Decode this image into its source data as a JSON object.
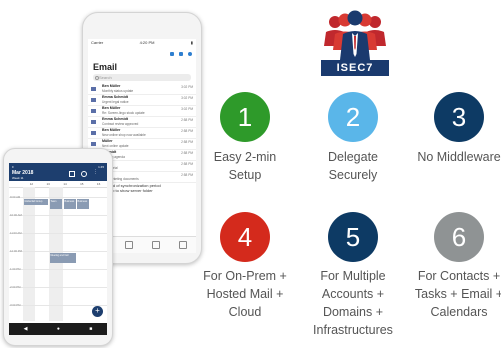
{
  "email_app": {
    "carrier": "Carrier",
    "clock": "4:20 PM",
    "title": "Email",
    "search_placeholder": "Search",
    "messages": [
      {
        "from": "Ben Müller",
        "subject": "Monthly status update",
        "time": "3:02 PM"
      },
      {
        "from": "Emma Schmidt",
        "subject": "Urgent legal notice",
        "time": "3:02 PM"
      },
      {
        "from": "Ben Müller",
        "subject": "Re: Screen-lingo stock update",
        "time": "3:02 PM"
      },
      {
        "from": "Emma Schmidt",
        "subject": "Contract review approved",
        "time": "2:58 PM"
      },
      {
        "from": "Ben Müller",
        "subject": "New online shop now available",
        "time": "2:58 PM"
      },
      {
        "from": "Müller",
        "subject": "Next online update",
        "time": "2:58 PM"
      },
      {
        "from": "Schmidt",
        "subject": "meeting agenda",
        "time": "2:58 PM"
      },
      {
        "from": "Müller",
        "subject": "up material",
        "time": "2:58 PM"
      },
      {
        "from": "Müller",
        "subject": "3 of marketing documents",
        "time": "2:58 PM"
      }
    ],
    "sync_line1": "End of synchronization period",
    "sync_line2": "Tap to show server folder"
  },
  "calendar_app": {
    "clock": "1:45",
    "month": "Mar 2018",
    "week": "Week 11",
    "days": [
      "12",
      "13",
      "14",
      "15",
      "16"
    ],
    "times": [
      "9:00 AM",
      "10:00 AM",
      "11:00 AM",
      "12:00 PM",
      "1:00 PM",
      "2:00 PM",
      "3:00 PM"
    ],
    "events": [
      "Global Ed Group",
      "Team",
      "Business",
      "Business",
      "Meeting and Call"
    ],
    "fab": "+"
  },
  "logo": {
    "text": "ISEC7"
  },
  "features": [
    {
      "number": "1",
      "label": "Easy 2-min\nSetup",
      "color": "#2e9a2a"
    },
    {
      "number": "2",
      "label": "Delegate\nSecurely",
      "color": "#5ab6e9"
    },
    {
      "number": "3",
      "label": "No Middleware",
      "color": "#0d3a64"
    },
    {
      "number": "4",
      "label": "For On-Prem +\nHosted Mail +\nCloud",
      "color": "#d42a1c"
    },
    {
      "number": "5",
      "label": "For Multiple\nAccounts +\nDomains +\nInfrastructures",
      "color": "#0d3a64"
    },
    {
      "number": "6",
      "label": "For Contacts +\nTasks + Email +\nCalendars",
      "color": "#8f9394"
    }
  ]
}
